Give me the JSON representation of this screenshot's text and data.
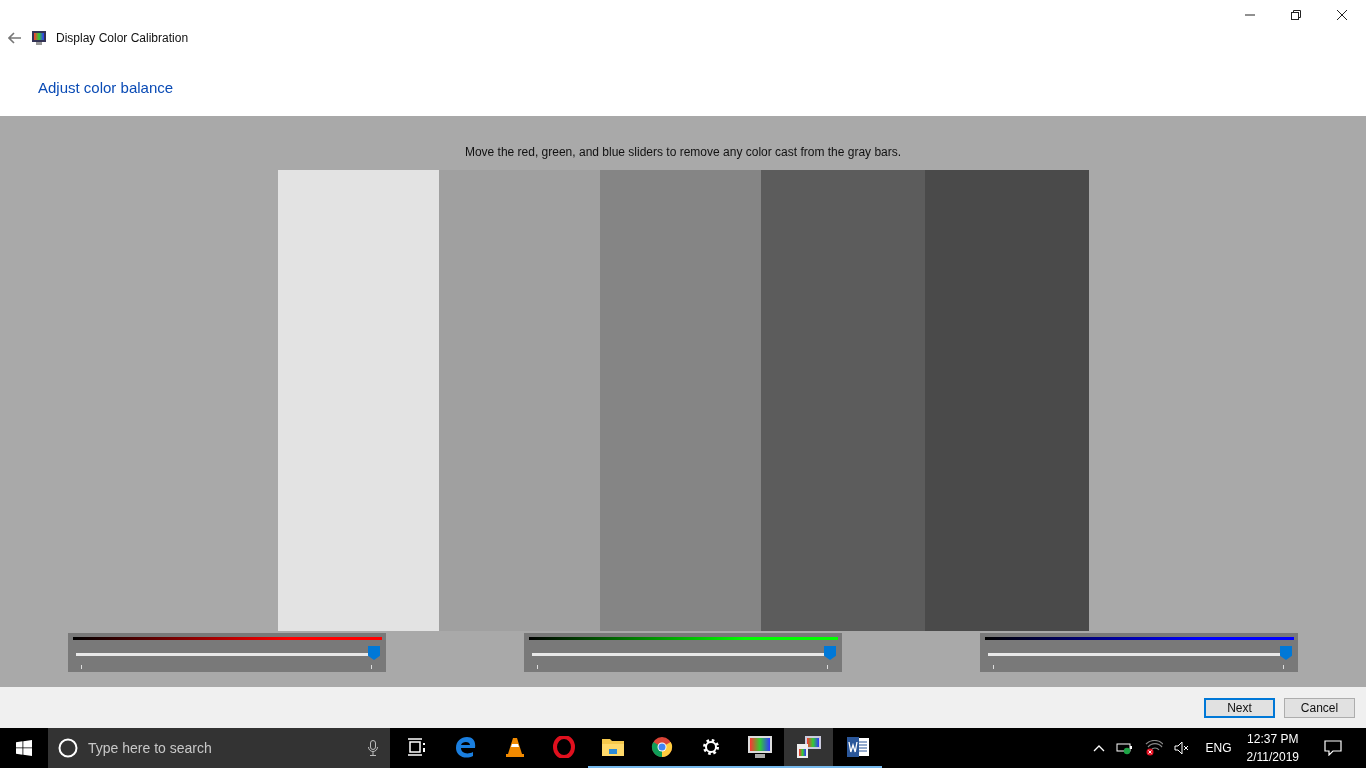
{
  "window": {
    "title": "Display Color Calibration"
  },
  "heading": "Adjust color balance",
  "instruction": "Move the red, green, and blue sliders to remove any color cast from the gray bars.",
  "gray_bars": [
    {
      "color": "#e3e3e3"
    },
    {
      "color": "#a0a0a0"
    },
    {
      "color": "#858585"
    },
    {
      "color": "#5c5c5c"
    },
    {
      "color": "#4a4a4a"
    }
  ],
  "sliders": [
    {
      "color": "#ff0000",
      "level": 1
    },
    {
      "color": "#00ff00",
      "level": 1
    },
    {
      "color": "#0000ff",
      "level": 1
    }
  ],
  "buttons": [
    {
      "label": "Next",
      "default": true
    },
    {
      "label": "Cancel",
      "default": false
    }
  ],
  "taskbar": {
    "search": {
      "placeholder": "Type here to search"
    },
    "apps": [
      {
        "kind": "task-view",
        "running": false,
        "selected": false
      },
      {
        "kind": "edge",
        "running": false,
        "selected": false
      },
      {
        "kind": "vlc",
        "running": false,
        "selected": false
      },
      {
        "kind": "opera",
        "running": false,
        "selected": false
      },
      {
        "kind": "explorer",
        "running": true,
        "selected": false
      },
      {
        "kind": "chrome",
        "running": true,
        "selected": false
      },
      {
        "kind": "settings",
        "running": true,
        "selected": false
      },
      {
        "kind": "display",
        "running": true,
        "selected": false
      },
      {
        "kind": "calibration",
        "running": true,
        "selected": true
      },
      {
        "kind": "word",
        "running": true,
        "selected": false
      }
    ],
    "language": "ENG",
    "time": "12:37 PM",
    "date": "2/11/2019"
  }
}
